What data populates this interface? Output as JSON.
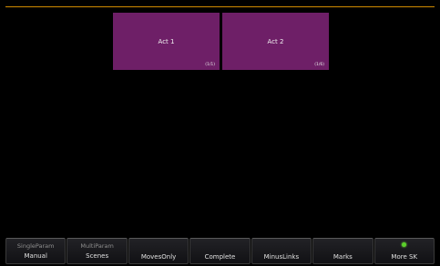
{
  "scenes": [
    {
      "label": "Act 1",
      "count": "(1/1)"
    },
    {
      "label": "Act 2",
      "count": "(1/6)"
    }
  ],
  "softkeys": {
    "single_param": {
      "top": "SingleParam",
      "bottom": "Manual"
    },
    "multi_param": {
      "top": "MultiParam",
      "bottom": "Scenes"
    },
    "moves_only": {
      "label": "MovesOnly"
    },
    "complete": {
      "label": "Complete"
    },
    "minus_links": {
      "label": "MinusLinks"
    },
    "marks": {
      "label": "Marks"
    },
    "more_sk": {
      "label": "More SK",
      "indicator": "green-led"
    }
  },
  "colors": {
    "background": "#000000",
    "scene_tile": "#6e1f67",
    "top_rule": "#d08a00",
    "led": "#5ad02a"
  }
}
